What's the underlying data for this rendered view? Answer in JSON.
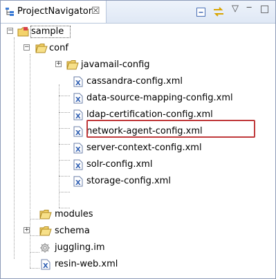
{
  "view": {
    "tab_label": "ProjectNavigator",
    "tab_close": "☒",
    "tools": {
      "collapse_all": "⊟",
      "link_editor": "⇆",
      "view_menu": "▽",
      "minimize": "‒",
      "maximize": "□"
    }
  },
  "tree": {
    "sample": "sample",
    "conf": "conf",
    "javamail_config": "javamail-config",
    "cassandra": "cassandra-config.xml",
    "data_source": "data-source-mapping-config.xml",
    "ldap": "ldap-certification-config.xml",
    "network_agent": "network-agent-config.xml",
    "server_context": "server-context-config.xml",
    "solr": "solr-config.xml",
    "storage": "storage-config.xml",
    "modules": "modules",
    "schema": "schema",
    "juggling": "juggling.im",
    "resin_web": "resin-web.xml"
  },
  "expanders": {
    "plus": "+",
    "minus": "−"
  },
  "colors": {
    "highlight": "#c0393b",
    "folder": "#f3d36b",
    "xml_icon": "#2f5fb3"
  }
}
